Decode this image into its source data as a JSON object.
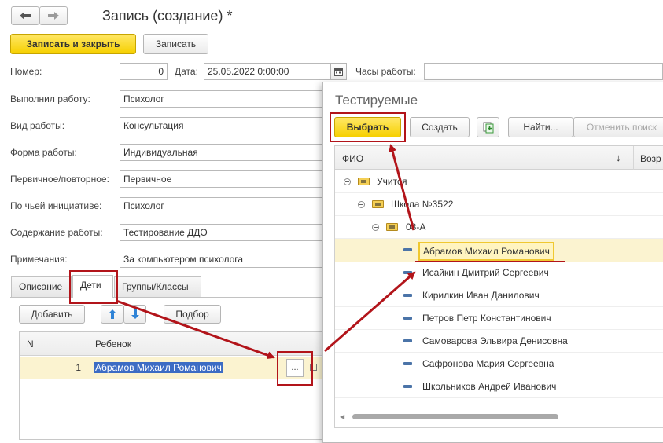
{
  "window": {
    "title": "Запись (создание) *"
  },
  "nav": {
    "back_icon": "arrow-left-icon",
    "forward_icon": "arrow-right-icon"
  },
  "toolbar": {
    "save_close_label": "Записать и закрыть",
    "save_label": "Записать"
  },
  "form": {
    "number_label": "Номер:",
    "number_value": "0",
    "date_label": "Дата:",
    "date_value": "25.05.2022  0:00:00",
    "hours_label": "Часы работы:",
    "hours_value": "",
    "fields": [
      {
        "label": "Выполнил работу:",
        "value": "Психолог"
      },
      {
        "label": "Вид работы:",
        "value": "Консультация"
      },
      {
        "label": "Форма работы:",
        "value": "Индивидуальная"
      },
      {
        "label": "Первичное/повторное:",
        "value": "Первичное"
      },
      {
        "label": "По чьей инициативе:",
        "value": "Психолог"
      },
      {
        "label": "Содержание работы:",
        "value": "Тестирование ДДО"
      },
      {
        "label": "Примечания:",
        "value": "За компьютером психолога"
      }
    ]
  },
  "tabs": [
    {
      "label": "Описание"
    },
    {
      "label": "Дети"
    },
    {
      "label": "Группы/Классы"
    }
  ],
  "children_panel": {
    "add_label": "Добавить",
    "pick_label": "Подбор",
    "columns": {
      "n": "N",
      "child": "Ребенок"
    },
    "rows": [
      {
        "n": "1",
        "child": "Абрамов Михаил Романович"
      }
    ],
    "ellipsis": "..."
  },
  "popup": {
    "title": "Тестируемые",
    "select_label": "Выбрать",
    "create_label": "Создать",
    "find_label": "Найти...",
    "cancel_search_label": "Отменить поиск",
    "col_fio": "ФИО",
    "sort_arrow": "↓",
    "col_age": "Возр",
    "groups": [
      {
        "label": "Учится"
      },
      {
        "label": "Школа №3522"
      },
      {
        "label": "08-А"
      }
    ],
    "people": [
      {
        "name": "Абрамов Михаил Романович"
      },
      {
        "name": "Исайкин Дмитрий Сергеевич"
      },
      {
        "name": "Кирилкин Иван Данилович"
      },
      {
        "name": "Петров Петр Константинович"
      },
      {
        "name": "Самоварова Эльвира Денисовна"
      },
      {
        "name": "Сафронова Мария Сергеевна"
      },
      {
        "name": "Школьников Андрей Иванович"
      }
    ]
  },
  "colors": {
    "accent_yellow": "#f6d000",
    "highlight_row": "#fbf3d0",
    "annotation_red": "#b2141a",
    "selection_blue": "#3c6cc4"
  }
}
